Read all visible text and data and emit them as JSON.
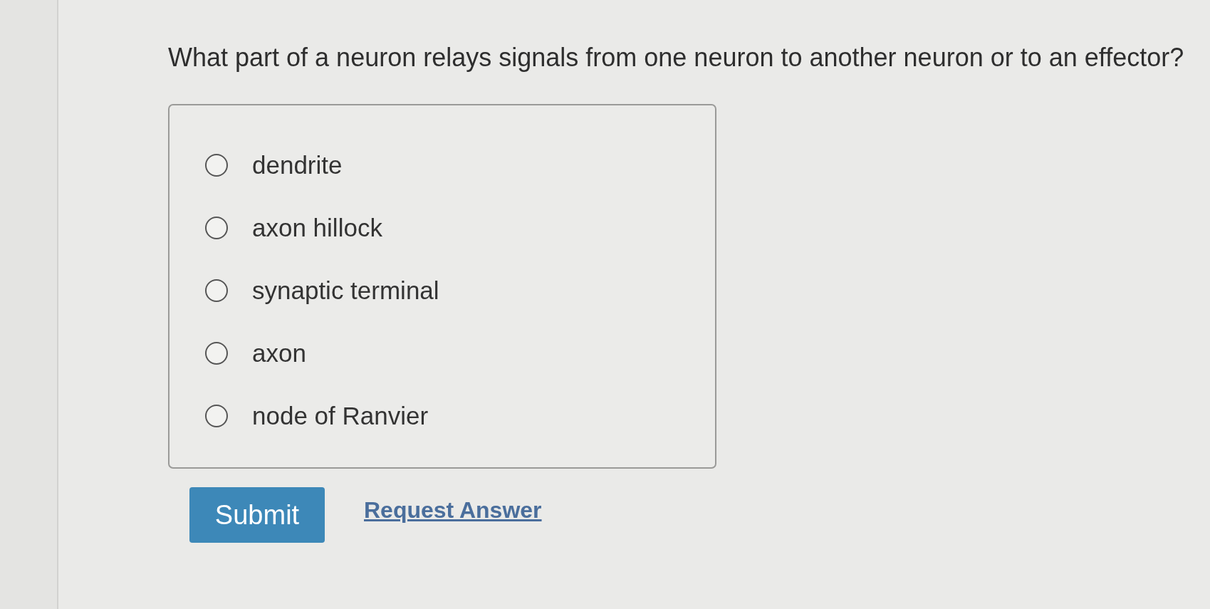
{
  "question": "What part of a neuron relays signals from one neuron to another neuron or to an effector?",
  "options": [
    {
      "label": "dendrite",
      "selected": false
    },
    {
      "label": "axon hillock",
      "selected": false
    },
    {
      "label": "synaptic terminal",
      "selected": false
    },
    {
      "label": "axon",
      "selected": false
    },
    {
      "label": "node of Ranvier",
      "selected": false
    }
  ],
  "actions": {
    "submit": "Submit",
    "request_answer": "Request Answer"
  }
}
